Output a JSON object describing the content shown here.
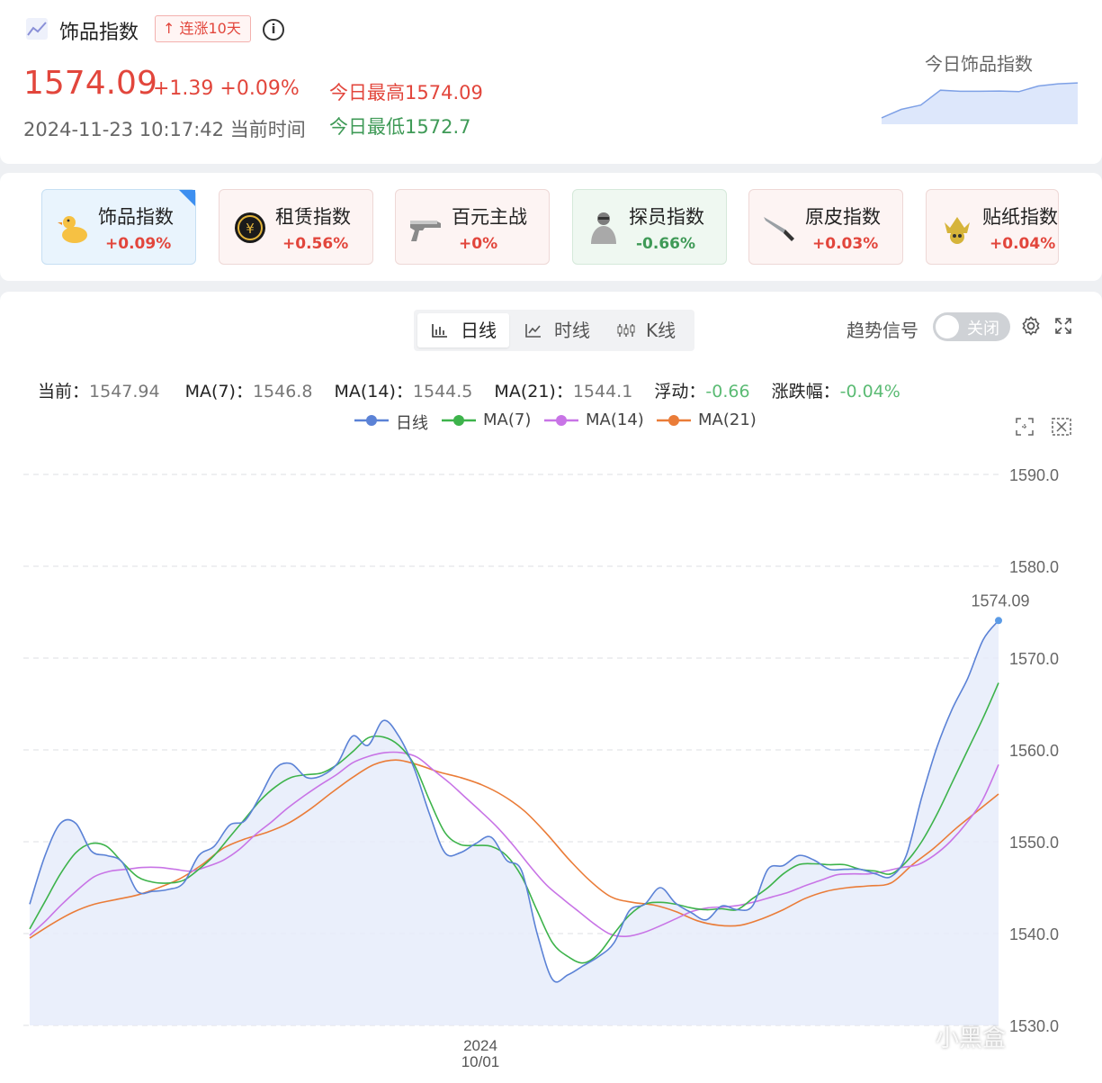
{
  "header": {
    "icon": "trend-chart-icon",
    "title": "饰品指数",
    "badge": "↑ 连涨10天",
    "info_icon": "info-icon",
    "price": "1574.09",
    "change": "+1.39 +0.09%",
    "datetime": "2024-11-23 10:17:42 当前时间",
    "today_high": "今日最高1574.09",
    "today_low": "今日最低1572.7",
    "mini_chart_title": "今日饰品指数",
    "mini_chart_values": [
      1543,
      1547,
      1549,
      1556,
      1555.5,
      1555.5,
      1555.6,
      1555.3,
      1558,
      1559,
      1559.4
    ]
  },
  "cards": [
    {
      "name": "饰品指数",
      "pct": "+0.09%",
      "icon": "duck-icon",
      "state": "selected",
      "color": "#e2463c"
    },
    {
      "name": "租赁指数",
      "pct": "+0.56%",
      "icon": "rent-coin-icon",
      "state": "up",
      "color": "#e2463c"
    },
    {
      "name": "百元主战",
      "pct": "+0%",
      "icon": "pistol-icon",
      "state": "up",
      "color": "#e2463c"
    },
    {
      "name": "探员指数",
      "pct": "-0.66%",
      "icon": "agent-icon",
      "state": "down",
      "color": "#3f9a57"
    },
    {
      "name": "原皮指数",
      "pct": "+0.03%",
      "icon": "knife-icon",
      "state": "up",
      "color": "#e2463c"
    },
    {
      "name": "贴纸指数",
      "pct": "+0.04%",
      "icon": "crown-skull-sticker-icon",
      "state": "up",
      "color": "#e2463c"
    }
  ],
  "tabs": {
    "daily": "日线",
    "intraday": "时线",
    "kline": "K线"
  },
  "trend_signal": {
    "label": "趋势信号",
    "toggle": "关闭"
  },
  "stats": {
    "current_label": "当前：",
    "current": "1547.94",
    "ma7_label": "MA(7)：",
    "ma7": "1546.8",
    "ma14_label": "MA(14)：",
    "ma14": "1544.5",
    "ma21_label": "MA(21)：",
    "ma21": "1544.1",
    "float_label": "浮动：",
    "float": "-0.66",
    "pct_label": "涨跌幅：",
    "pct": "-0.04%"
  },
  "watermark": "小黑盒",
  "chart_data": {
    "type": "line",
    "y_range": [
      1530,
      1590
    ],
    "y_ticks": [
      1590.0,
      1580.0,
      1570.0,
      1560.0,
      1550.0,
      1540.0,
      1530.0
    ],
    "y_tick_labels": [
      "1590.0",
      "1580.0",
      "1570.0",
      "1560.0",
      "1550.0",
      "1540.0",
      "1530.0"
    ],
    "x_tick_label": [
      "2024",
      "10/01"
    ],
    "last_value_label": "1574.09",
    "grid": true,
    "legend_position": "top-center",
    "series": [
      {
        "name": "日线",
        "color": "#5b82d6",
        "values": [
          1543.2,
          1548.5,
          1552,
          1552,
          1549,
          1548.5,
          1547.8,
          1544.6,
          1544.6,
          1544.8,
          1545.5,
          1548.5,
          1549.5,
          1551.8,
          1552.3,
          1555,
          1558,
          1558.5,
          1557,
          1557.2,
          1558.5,
          1561.5,
          1560.5,
          1563.2,
          1561.5,
          1558,
          1553,
          1548.8,
          1548.8,
          1549.8,
          1550.5,
          1548,
          1546.8,
          1540,
          1535,
          1535.5,
          1536.5,
          1537.5,
          1539,
          1542.5,
          1543.2,
          1545,
          1543.3,
          1542.3,
          1541.5,
          1543,
          1542.6,
          1543,
          1547,
          1547.4,
          1548.5,
          1548,
          1547,
          1547,
          1547,
          1546.5,
          1546.2,
          1548.5,
          1554.8,
          1560.3,
          1564.5,
          1567.8,
          1572,
          1574.09
        ]
      },
      {
        "name": "MA(7)",
        "color": "#3db34b",
        "values": [
          1540.5,
          1543.5,
          1546.5,
          1548.8,
          1549.8,
          1549.5,
          1547.8,
          1546.2,
          1545.6,
          1545.5,
          1545.8,
          1547,
          1548.5,
          1550.5,
          1552.5,
          1554.5,
          1556,
          1557,
          1557.3,
          1557.5,
          1558.4,
          1559.8,
          1561.3,
          1561.4,
          1560.5,
          1558.4,
          1554.5,
          1551,
          1549.7,
          1549.6,
          1549.5,
          1548.5,
          1546.2,
          1542.5,
          1539,
          1537.5,
          1536.8,
          1537.8,
          1540,
          1542,
          1543.2,
          1543.4,
          1543.2,
          1542.8,
          1542.6,
          1542.7,
          1542.6,
          1543.8,
          1545,
          1546.5,
          1547.5,
          1547.6,
          1547.5,
          1547.5,
          1547,
          1546.8,
          1546.5,
          1547.8,
          1550,
          1553,
          1556.5,
          1560,
          1563.5,
          1567.3
        ]
      },
      {
        "name": "MA(14)",
        "color": "#c874e6",
        "values": [
          1539.8,
          1541.4,
          1543.2,
          1544.8,
          1546.2,
          1546.8,
          1547,
          1547.2,
          1547.2,
          1547,
          1546.8,
          1547.3,
          1548,
          1549.2,
          1550.8,
          1552.2,
          1553.7,
          1555,
          1556.2,
          1557.3,
          1558.6,
          1559.3,
          1559.7,
          1559.7,
          1559.2,
          1557.8,
          1556.4,
          1554.8,
          1553.2,
          1551.5,
          1549.5,
          1547.3,
          1545.3,
          1543.8,
          1542.4,
          1541,
          1539.9,
          1539.7,
          1540.1,
          1540.8,
          1541.6,
          1542.4,
          1542.8,
          1542.9,
          1543.1,
          1543.5,
          1544,
          1544.5,
          1545.2,
          1545.8,
          1546.4,
          1546.5,
          1546.5,
          1546.8,
          1547.2,
          1547.5,
          1548.5,
          1550,
          1552,
          1554.5,
          1558.4
        ]
      },
      {
        "name": "MA(21)",
        "color": "#ea7c38",
        "values": [
          1539.5,
          1541,
          1542.3,
          1543.2,
          1543.7,
          1544.2,
          1545,
          1546,
          1547.5,
          1549.3,
          1550.3,
          1551,
          1552,
          1553.5,
          1555.3,
          1557,
          1558.4,
          1558.9,
          1558.4,
          1557.6,
          1557,
          1556.2,
          1555,
          1553.3,
          1550.9,
          1548.2,
          1545.8,
          1544,
          1543.4,
          1543.1,
          1542.4,
          1541.4,
          1540.9,
          1540.9,
          1541.6,
          1542.6,
          1543.8,
          1544.6,
          1545,
          1545.2,
          1545.5,
          1547.5,
          1549.3,
          1551.4,
          1553.3,
          1555.2
        ]
      }
    ]
  }
}
